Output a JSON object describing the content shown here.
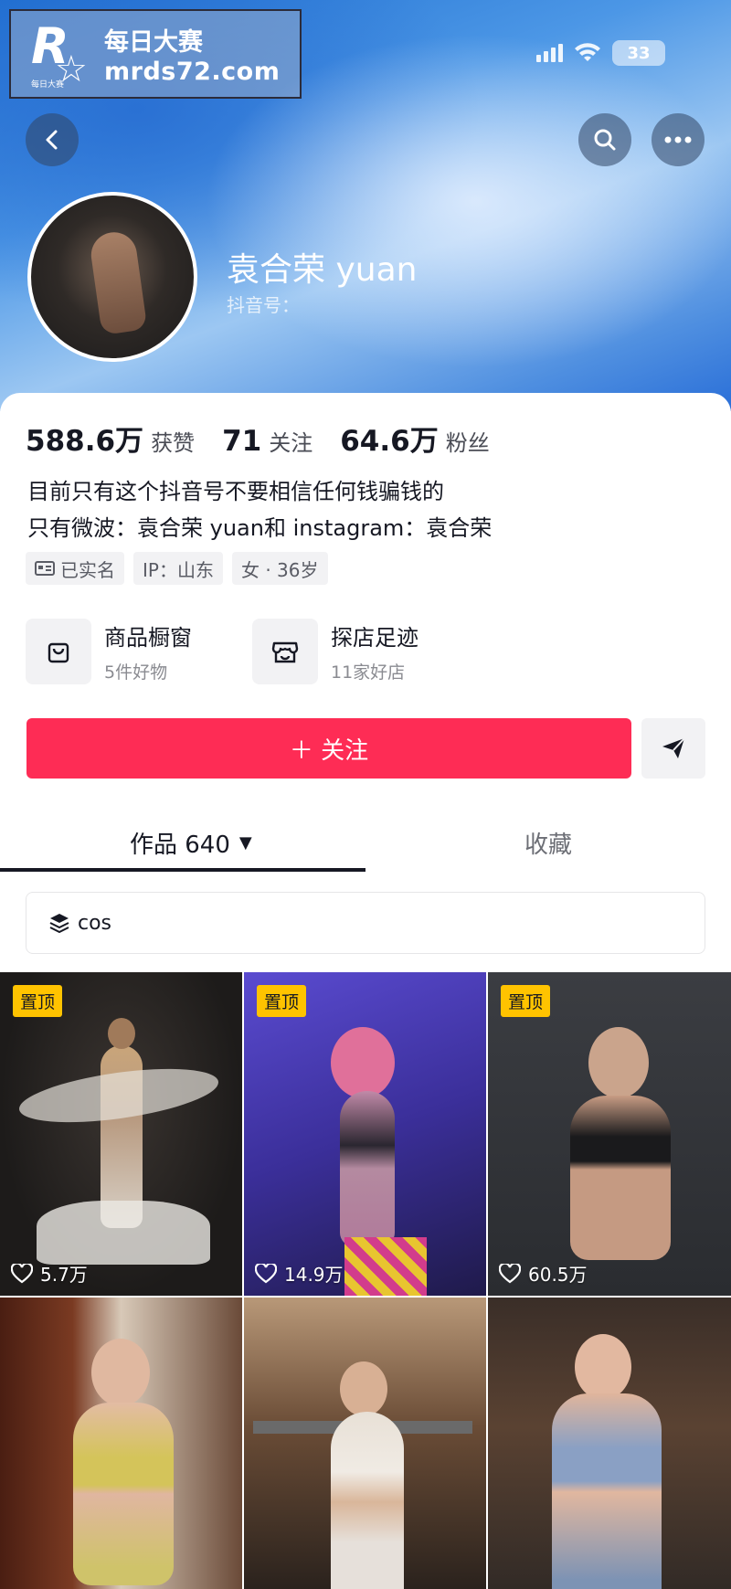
{
  "watermark": {
    "brand_cn": "每日大赛",
    "url": "mrds72.com",
    "logo_letter": "R",
    "logo_small": "每日大赛"
  },
  "status_bar": {
    "battery": "33"
  },
  "profile": {
    "nickname": "袁合荣 yuan",
    "douyin_id_label": "抖音号：",
    "stats": [
      {
        "value": "588.6万",
        "label": "获赞"
      },
      {
        "value": "71",
        "label": "关注"
      },
      {
        "value": "64.6万",
        "label": "粉丝"
      }
    ],
    "bio_line1": "目前只有这个抖音号不要相信任何钱骗钱的",
    "bio_line2": "只有微波：袁合荣 yuan和 instagram：袁合荣",
    "tags": [
      "已实名",
      "IP：山东",
      "女 · 36岁"
    ]
  },
  "shortcuts": [
    {
      "title": "商品橱窗",
      "subtitle": "5件好物",
      "icon": "shopping-bag-icon"
    },
    {
      "title": "探店足迹",
      "subtitle": "11家好店",
      "icon": "store-icon"
    }
  ],
  "actions": {
    "follow_label": "＋ 关注"
  },
  "tabs": {
    "works_label": "作品 640",
    "works_caret": "▼",
    "favorites_label": "收藏"
  },
  "collection": {
    "label": "cos"
  },
  "videos": [
    {
      "pinned": "置顶",
      "likes": "5.7万"
    },
    {
      "pinned": "置顶",
      "likes": "14.9万"
    },
    {
      "pinned": "置顶",
      "likes": "60.5万"
    },
    {
      "pinned": "",
      "likes": ""
    },
    {
      "pinned": "",
      "likes": ""
    },
    {
      "pinned": "",
      "likes": ""
    }
  ],
  "colors": {
    "follow_button": "#fe2c55",
    "pin_badge": "#ffc300",
    "text": "#161823"
  }
}
